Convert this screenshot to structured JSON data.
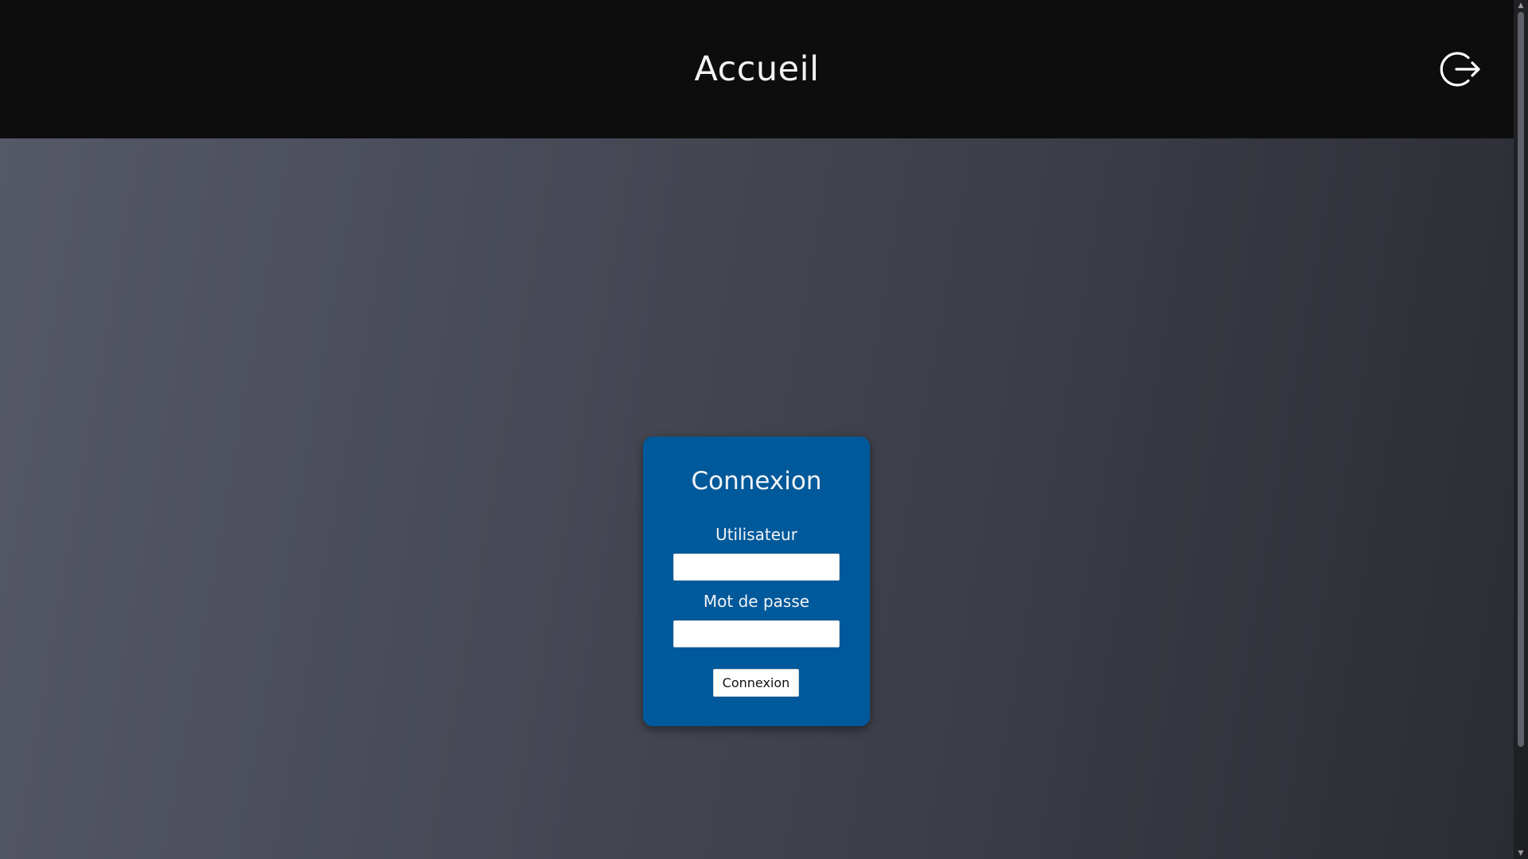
{
  "header": {
    "title": "Accueil",
    "logout_icon": "logout-icon"
  },
  "login": {
    "title": "Connexion",
    "username_label": "Utilisateur",
    "username_value": "",
    "password_label": "Mot de passe",
    "password_value": "",
    "submit_label": "Connexion"
  },
  "colors": {
    "header_bg": "#0d0d0e",
    "card_bg": "#00599a",
    "background_gradient_start": "#555865",
    "background_gradient_end": "#2b2c33"
  }
}
